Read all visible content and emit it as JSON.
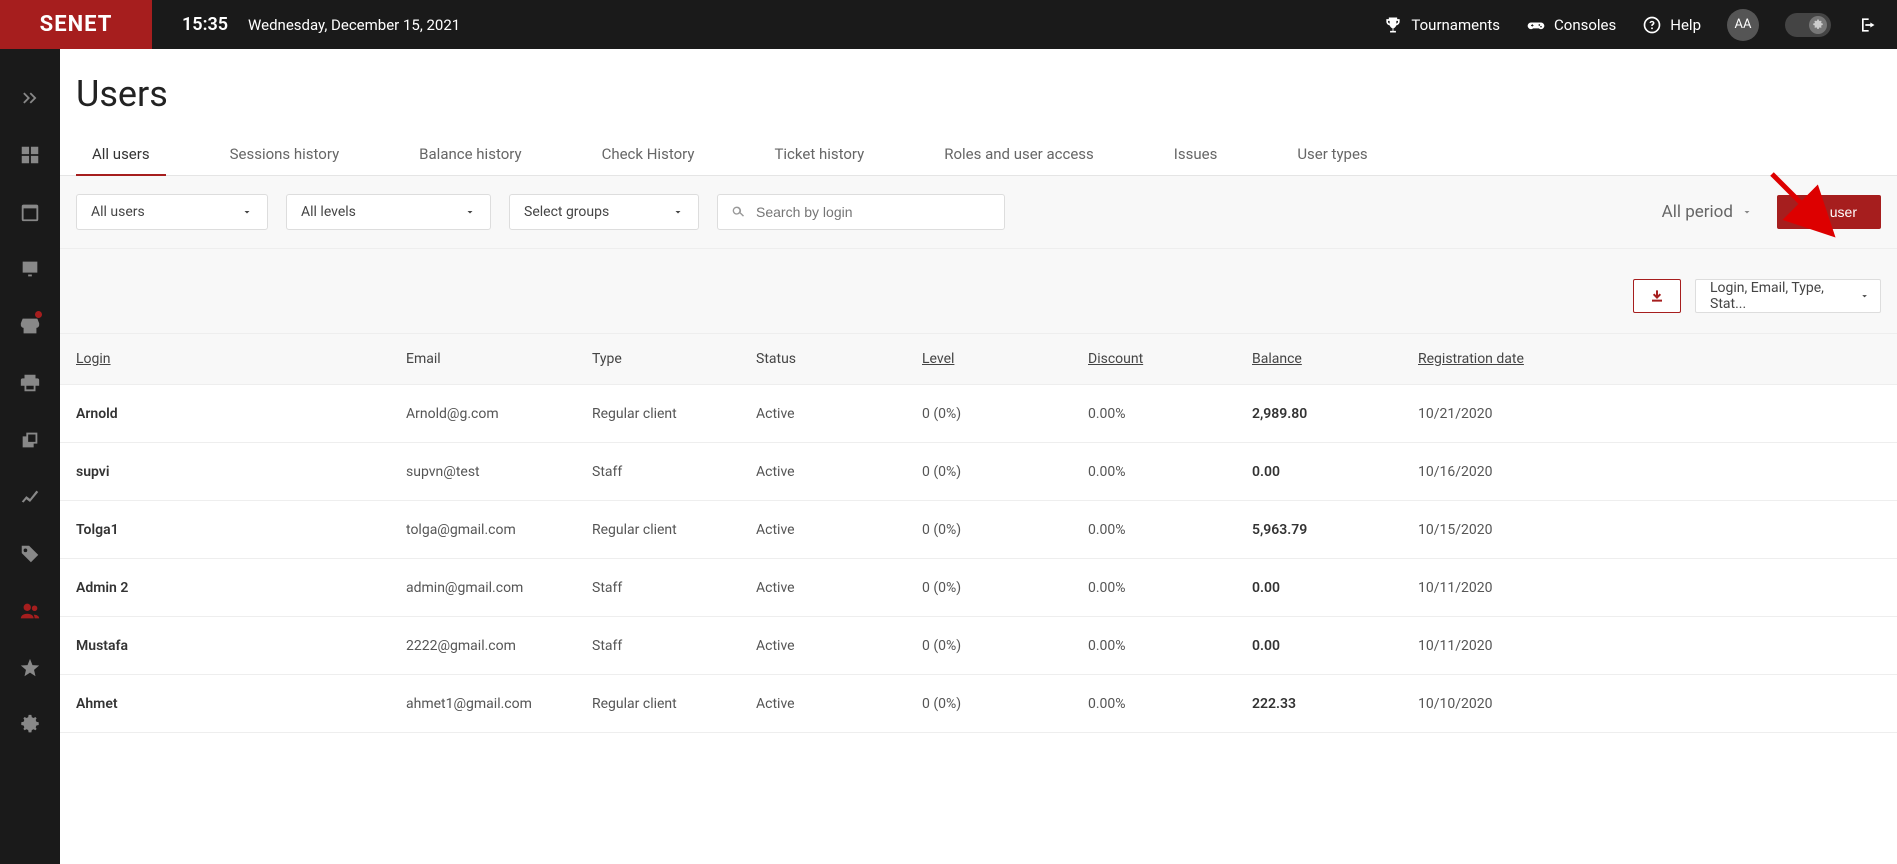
{
  "header": {
    "logo": "SENET",
    "time": "15:35",
    "date": "Wednesday, December 15, 2021",
    "tournaments": "Tournaments",
    "consoles": "Consoles",
    "help": "Help",
    "avatar": "AA"
  },
  "page": {
    "title": "Users"
  },
  "tabs": [
    "All users",
    "Sessions history",
    "Balance history",
    "Check History",
    "Ticket history",
    "Roles and user access",
    "Issues",
    "User types"
  ],
  "active_tab": 0,
  "filters": {
    "users_select": "All users",
    "levels_select": "All levels",
    "groups_select": "Select groups",
    "search_placeholder": "Search by login",
    "period": "All period",
    "add_user": "Add user",
    "columns": "Login, Email, Type, Stat..."
  },
  "table": {
    "headers": {
      "login": "Login",
      "email": "Email",
      "type": "Type",
      "status": "Status",
      "level": "Level",
      "discount": "Discount",
      "balance": "Balance",
      "registration": "Registration date"
    },
    "rows": [
      {
        "login": "Arnold",
        "email": "Arnold@g.com",
        "type": "Regular client",
        "status": "Active",
        "level": "0 (0%)",
        "discount": "0.00%",
        "balance": "2,989.80",
        "registration": "10/21/2020"
      },
      {
        "login": "supvi",
        "email": "supvn@test",
        "type": "Staff",
        "status": "Active",
        "level": "0 (0%)",
        "discount": "0.00%",
        "balance": "0.00",
        "registration": "10/16/2020"
      },
      {
        "login": "Tolga1",
        "email": "tolga@gmail.com",
        "type": "Regular client",
        "status": "Active",
        "level": "0 (0%)",
        "discount": "0.00%",
        "balance": "5,963.79",
        "registration": "10/15/2020"
      },
      {
        "login": "Admin 2",
        "email": "admin@gmail.com",
        "type": "Staff",
        "status": "Active",
        "level": "0 (0%)",
        "discount": "0.00%",
        "balance": "0.00",
        "registration": "10/11/2020"
      },
      {
        "login": "Mustafa",
        "email": "2222@gmail.com",
        "type": "Staff",
        "status": "Active",
        "level": "0 (0%)",
        "discount": "0.00%",
        "balance": "0.00",
        "registration": "10/11/2020"
      },
      {
        "login": "Ahmet",
        "email": "ahmet1@gmail.com",
        "type": "Regular client",
        "status": "Active",
        "level": "0 (0%)",
        "discount": "0.00%",
        "balance": "222.33",
        "registration": "10/10/2020"
      }
    ]
  }
}
